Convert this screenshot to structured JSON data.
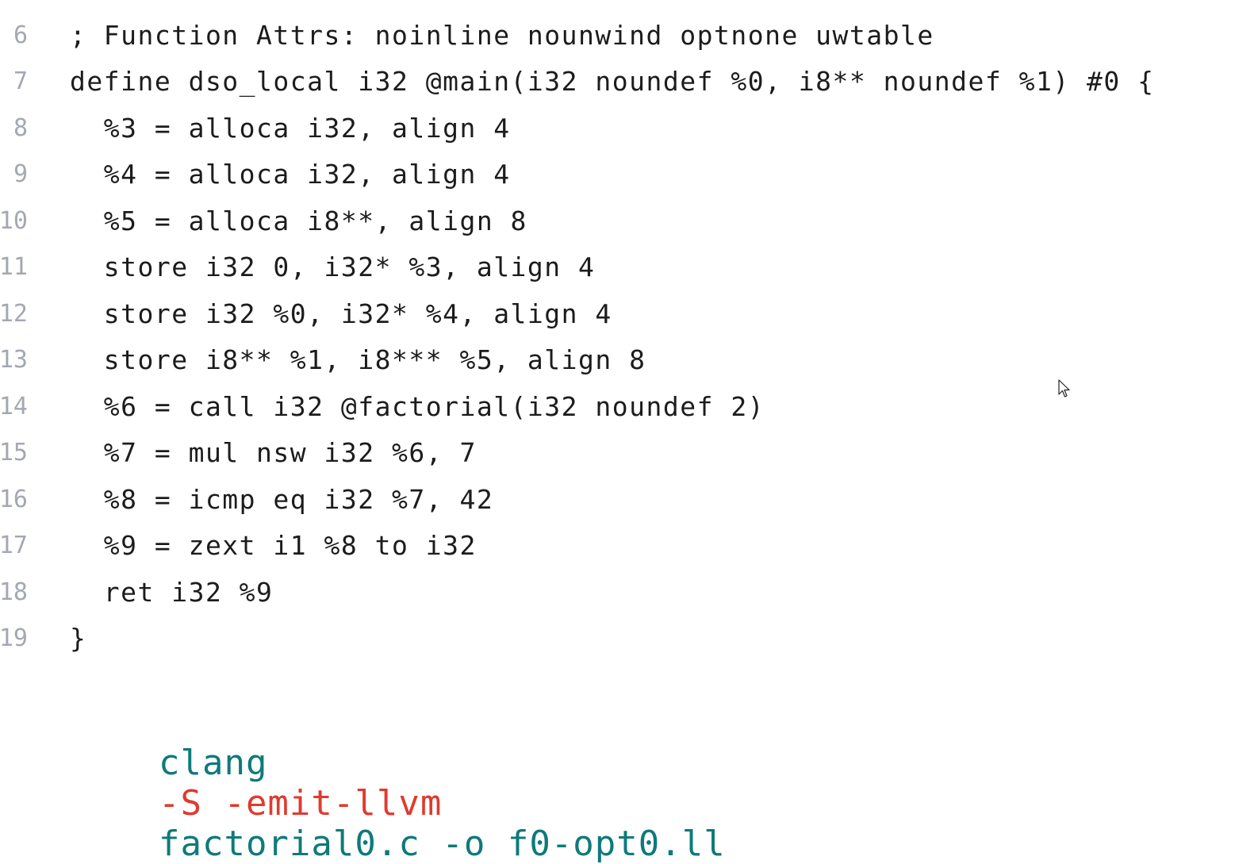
{
  "colors": {
    "teal": "#0e7a7a",
    "red": "#e03a2e",
    "code_text": "#1c1c1c",
    "line_number": "#a4a8b2"
  },
  "code": {
    "lines": [
      {
        "number": "6",
        "text": "; Function Attrs: noinline nounwind optnone uwtable"
      },
      {
        "number": "7",
        "text": "define dso_local i32 @main(i32 noundef %0, i8** noundef %1) #0 {"
      },
      {
        "number": "8",
        "text": "  %3 = alloca i32, align 4"
      },
      {
        "number": "9",
        "text": "  %4 = alloca i32, align 4"
      },
      {
        "number": "10",
        "text": "  %5 = alloca i8**, align 8"
      },
      {
        "number": "11",
        "text": "  store i32 0, i32* %3, align 4"
      },
      {
        "number": "12",
        "text": "  store i32 %0, i32* %4, align 4"
      },
      {
        "number": "13",
        "text": "  store i8** %1, i8*** %5, align 8"
      },
      {
        "number": "14",
        "text": "  %6 = call i32 @factorial(i32 noundef 2)"
      },
      {
        "number": "15",
        "text": "  %7 = mul nsw i32 %6, 7"
      },
      {
        "number": "16",
        "text": "  %8 = icmp eq i32 %7, 42"
      },
      {
        "number": "17",
        "text": "  %9 = zext i1 %8 to i32"
      },
      {
        "number": "18",
        "text": "  ret i32 %9"
      },
      {
        "number": "19",
        "text": "}"
      }
    ]
  },
  "command": {
    "tool": "clang",
    "flags": "-S -emit-llvm",
    "args": "factorial0.c -o f0-opt0.ll"
  },
  "icons": {
    "cursor": "mouse-pointer-icon"
  }
}
